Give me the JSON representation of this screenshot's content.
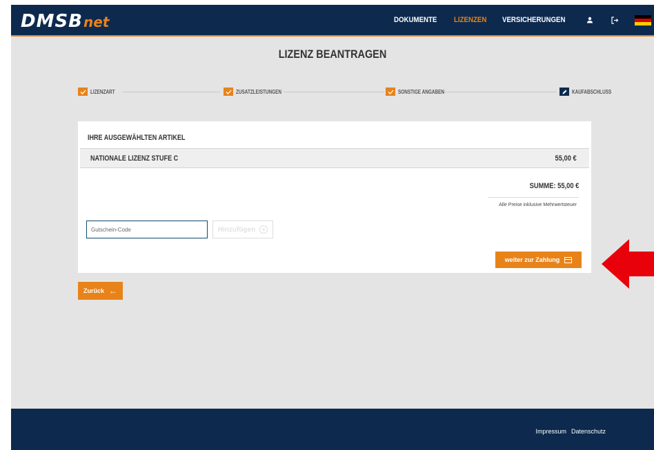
{
  "header": {
    "logo_main": "DMSB",
    "logo_net": "net",
    "nav": [
      {
        "label": "DOKUMENTE",
        "active": false
      },
      {
        "label": "LIZENZEN",
        "active": true
      },
      {
        "label": "VERSICHERUNGEN",
        "active": false
      }
    ],
    "icons": [
      "user-icon",
      "logout-icon",
      "german-flag-icon"
    ]
  },
  "page": {
    "title": "LIZENZ BEANTRAGEN"
  },
  "stepper": {
    "steps": [
      {
        "label": "LIZENZART",
        "status": "done"
      },
      {
        "label": "ZUSATZLEISTUNGEN",
        "status": "done"
      },
      {
        "label": "SONSTIGE ANGABEN",
        "status": "done"
      },
      {
        "label": "KAUFABSCHLUSS",
        "status": "current"
      }
    ]
  },
  "cart": {
    "title": "IHRE AUSGEWÄHLTEN ARTIKEL",
    "items": [
      {
        "name": "NATIONALE LIZENZ STUFE C",
        "price": "55,00 €"
      }
    ],
    "summe": "SUMME:  55,00 €",
    "tax_note": "Alle Preise inklusive Mehrwertsteuer",
    "voucher_placeholder": "Gutschein-Code",
    "add_label": "Hinzufügen",
    "pay_label": "weiter zur Zahlung"
  },
  "back_label": "Zurück",
  "footer": {
    "links": [
      "Impressum",
      "Datenschutz"
    ]
  },
  "colors": {
    "navy": "#0d2a4e",
    "orange": "#e8831a",
    "annotation_red": "#e8000b"
  }
}
